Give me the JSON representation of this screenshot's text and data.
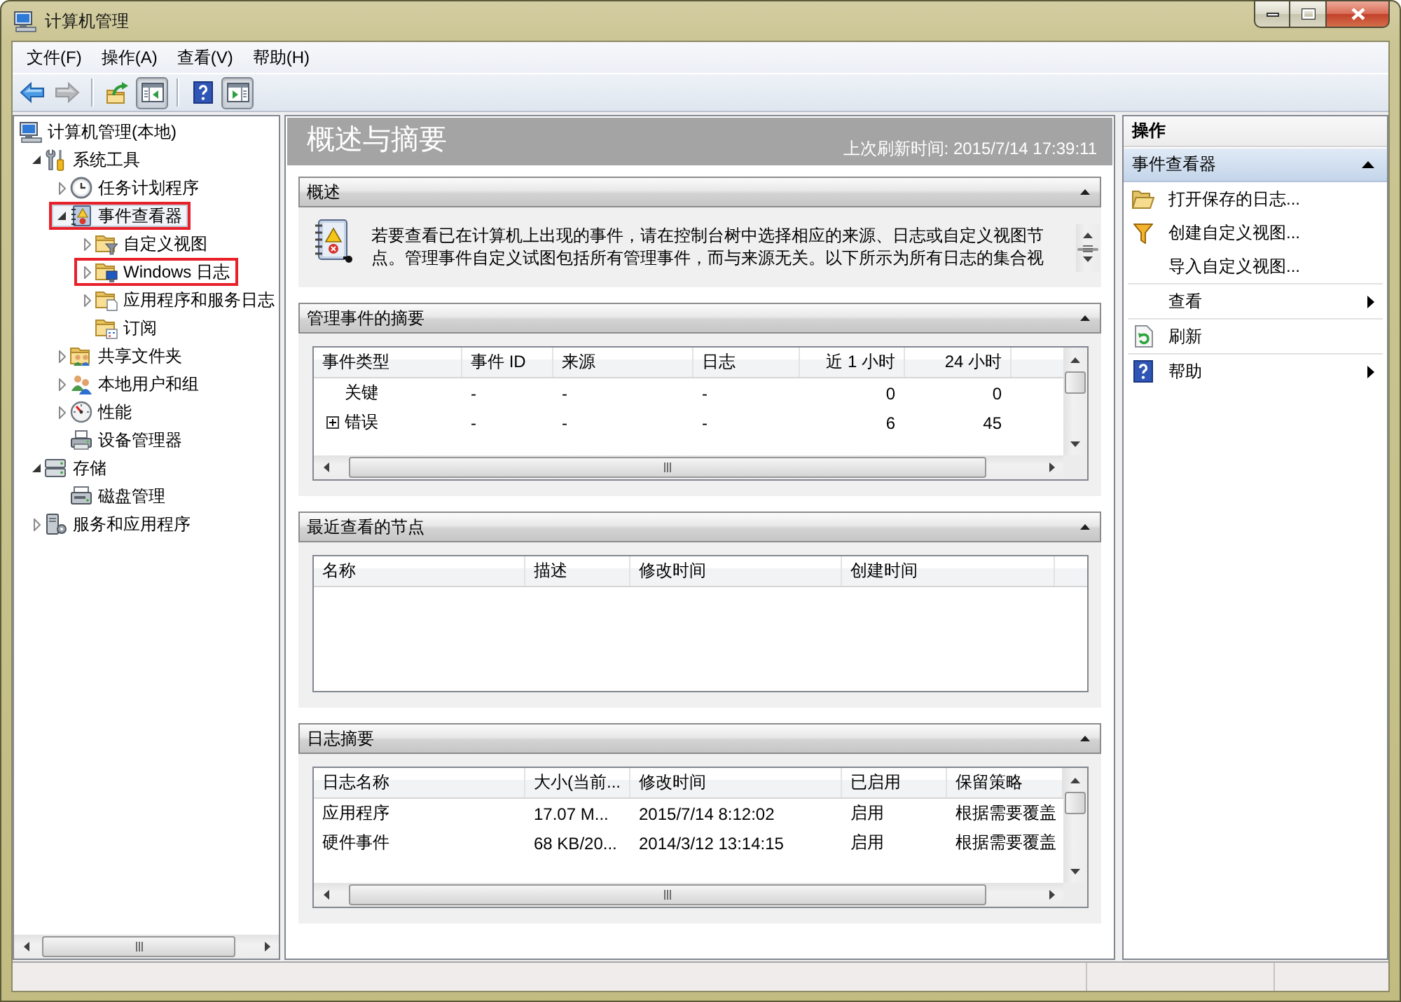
{
  "window": {
    "title": "计算机管理"
  },
  "menu": [
    {
      "label": "文件(F)"
    },
    {
      "label": "操作(A)"
    },
    {
      "label": "查看(V)"
    },
    {
      "label": "帮助(H)"
    }
  ],
  "toolbar": [
    [
      {
        "kind": "back",
        "disabled": false,
        "pressed": false
      },
      {
        "kind": "forward",
        "disabled": true,
        "pressed": false
      }
    ],
    [
      {
        "kind": "up",
        "disabled": false,
        "pressed": false
      },
      {
        "kind": "tree-pane",
        "disabled": false,
        "pressed": true
      }
    ],
    [
      {
        "kind": "help",
        "disabled": false,
        "pressed": false
      },
      {
        "kind": "action-pane",
        "disabled": false,
        "pressed": true
      }
    ]
  ],
  "tree": [
    {
      "label": "计算机管理(本地)",
      "kind": "computer",
      "selected": false,
      "highlighted": false,
      "children": [
        {
          "label": "系统工具",
          "kind": "tools",
          "expanded": true,
          "selected": false,
          "highlighted": false,
          "children": [
            {
              "label": "任务计划程序",
              "kind": "scheduler",
              "expanded": false,
              "selected": false,
              "highlighted": false
            },
            {
              "label": "事件查看器",
              "kind": "event-viewer",
              "expanded": true,
              "selected": true,
              "highlighted": true,
              "children": [
                {
                  "label": "自定义视图",
                  "kind": "filter-folder",
                  "expanded": false,
                  "selected": false,
                  "highlighted": false
                },
                {
                  "label": "Windows 日志",
                  "kind": "log-folder",
                  "expanded": false,
                  "selected": false,
                  "highlighted": true
                },
                {
                  "label": "应用程序和服务日志",
                  "kind": "app-folder",
                  "expanded": false,
                  "selected": false,
                  "highlighted": false
                },
                {
                  "label": "订阅",
                  "kind": "subscription-folder",
                  "selected": false,
                  "highlighted": false
                }
              ]
            },
            {
              "label": "共享文件夹",
              "kind": "shared-folder",
              "expanded": false,
              "selected": false,
              "highlighted": false
            },
            {
              "label": "本地用户和组",
              "kind": "users",
              "expanded": false,
              "selected": false,
              "highlighted": false
            },
            {
              "label": "性能",
              "kind": "performance",
              "expanded": false,
              "selected": false,
              "highlighted": false
            },
            {
              "label": "设备管理器",
              "kind": "device-manager",
              "selected": false,
              "highlighted": false
            }
          ]
        },
        {
          "label": "存储",
          "kind": "storage",
          "expanded": true,
          "selected": false,
          "highlighted": false,
          "children": [
            {
              "label": "磁盘管理",
              "kind": "disk",
              "selected": false,
              "highlighted": false
            }
          ]
        },
        {
          "label": "服务和应用程序",
          "kind": "services",
          "expanded": false,
          "selected": false,
          "highlighted": false
        }
      ]
    }
  ],
  "overview": {
    "title": "概述与摘要",
    "refresh_time": "上次刷新时间: 2015/7/14 17:39:11",
    "sections": [
      {
        "kind": "text",
        "title": "概述",
        "expanded": true,
        "text": "若要查看已在计算机上出现的事件，请在控制台树中选择相应的来源、日志或自定义视图节点。管理事件自定义试图包括所有管理事件，而与来源无关。以下所示为所有日志的集合视"
      },
      {
        "kind": "table",
        "title": "管理事件的摘要",
        "expanded": true,
        "columns": [
          {
            "label": "事件类型",
            "kind": "text"
          },
          {
            "label": "事件 ID",
            "kind": "text"
          },
          {
            "label": "来源",
            "kind": "text"
          },
          {
            "label": "日志",
            "kind": "text"
          },
          {
            "label": "近 1 小时",
            "kind": "number"
          },
          {
            "label": "24 小时",
            "kind": "number"
          }
        ],
        "rows": [
          {
            "cells": [
              "关键",
              "-",
              "-",
              "-",
              "0",
              "0"
            ]
          },
          {
            "cells": [
              "错误",
              "-",
              "-",
              "-",
              "6",
              "45"
            ],
            "expanded": false
          }
        ]
      },
      {
        "kind": "table",
        "title": "最近查看的节点",
        "expanded": true,
        "columns": [
          {
            "label": "名称",
            "kind": "text"
          },
          {
            "label": "描述",
            "kind": "text"
          },
          {
            "label": "修改时间",
            "kind": "text"
          },
          {
            "label": "创建时间",
            "kind": "text"
          }
        ]
      },
      {
        "kind": "table",
        "title": "日志摘要",
        "expanded": true,
        "columns": [
          {
            "label": "日志名称",
            "kind": "text"
          },
          {
            "label": "大小(当前...",
            "kind": "text"
          },
          {
            "label": "修改时间",
            "kind": "text"
          },
          {
            "label": "已启用",
            "kind": "text"
          },
          {
            "label": "保留策略",
            "kind": "text"
          }
        ],
        "rows": [
          {
            "cells": [
              "应用程序",
              "17.07 M...",
              "2015/7/14 8:12:02",
              "启用",
              "根据需要覆盖"
            ]
          },
          {
            "cells": [
              "硬件事件",
              "68 KB/20...",
              "2014/3/12 13:14:15",
              "启用",
              "根据需要覆盖"
            ]
          }
        ]
      }
    ]
  },
  "actions": {
    "title": "操作",
    "section": {
      "title": "事件查看器",
      "expanded": true,
      "groups": [
        [
          {
            "label": "打开保存的日志...",
            "kind": "open",
            "submenu": false
          },
          {
            "label": "创建自定义视图...",
            "kind": "filter",
            "submenu": false
          },
          {
            "label": "导入自定义视图...",
            "kind": "plain",
            "submenu": false
          }
        ],
        [
          {
            "label": "查看",
            "kind": "plain",
            "submenu": true
          }
        ],
        [
          {
            "label": "刷新",
            "kind": "refresh",
            "submenu": false
          }
        ],
        [
          {
            "label": "帮助",
            "kind": "help",
            "submenu": true
          }
        ]
      ]
    }
  }
}
